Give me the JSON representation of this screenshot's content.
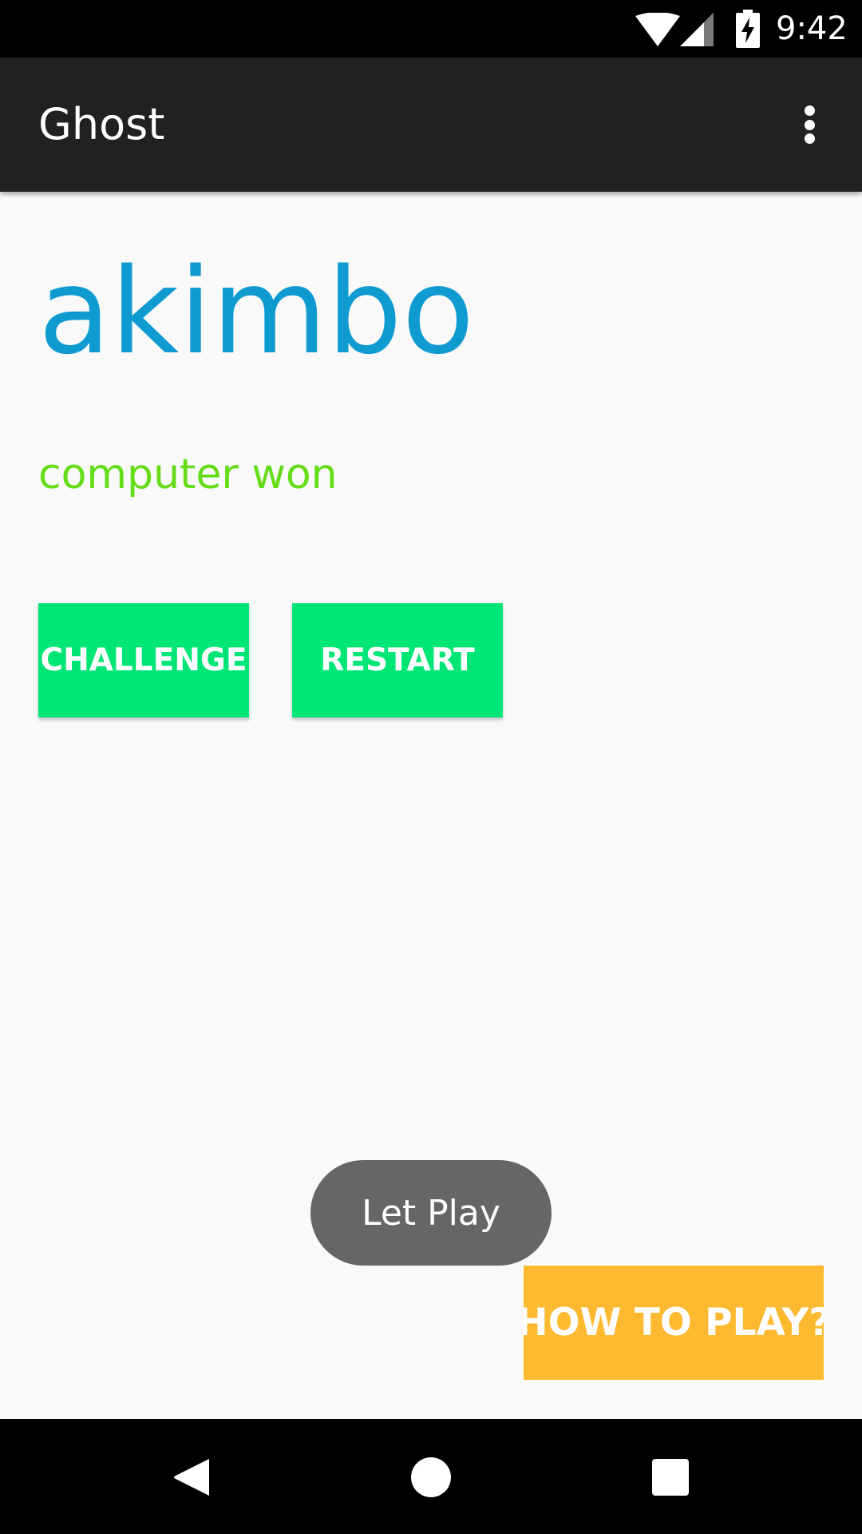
{
  "status_bar": {
    "time": "9:42",
    "icons": [
      "wifi-icon",
      "cell-signal-icon",
      "battery-charging-icon"
    ]
  },
  "app_bar": {
    "title": "Ghost",
    "menu_icon": "overflow-menu-icon"
  },
  "game": {
    "word": "akimbo",
    "status": "computer won",
    "challenge_label": "CHALLENGE",
    "restart_label": "RESTART"
  },
  "toast": {
    "message": "Let Play"
  },
  "help": {
    "label": "HOW TO PLAY?"
  },
  "nav_bar": {
    "icons": [
      "back-icon",
      "home-icon",
      "recents-icon"
    ]
  },
  "colors": {
    "app_bar": "#212121",
    "word": "#0f9bd0",
    "status": "#64dd17",
    "primary_button": "#00e676",
    "help_button": "#fdba31",
    "toast": "#666666"
  }
}
